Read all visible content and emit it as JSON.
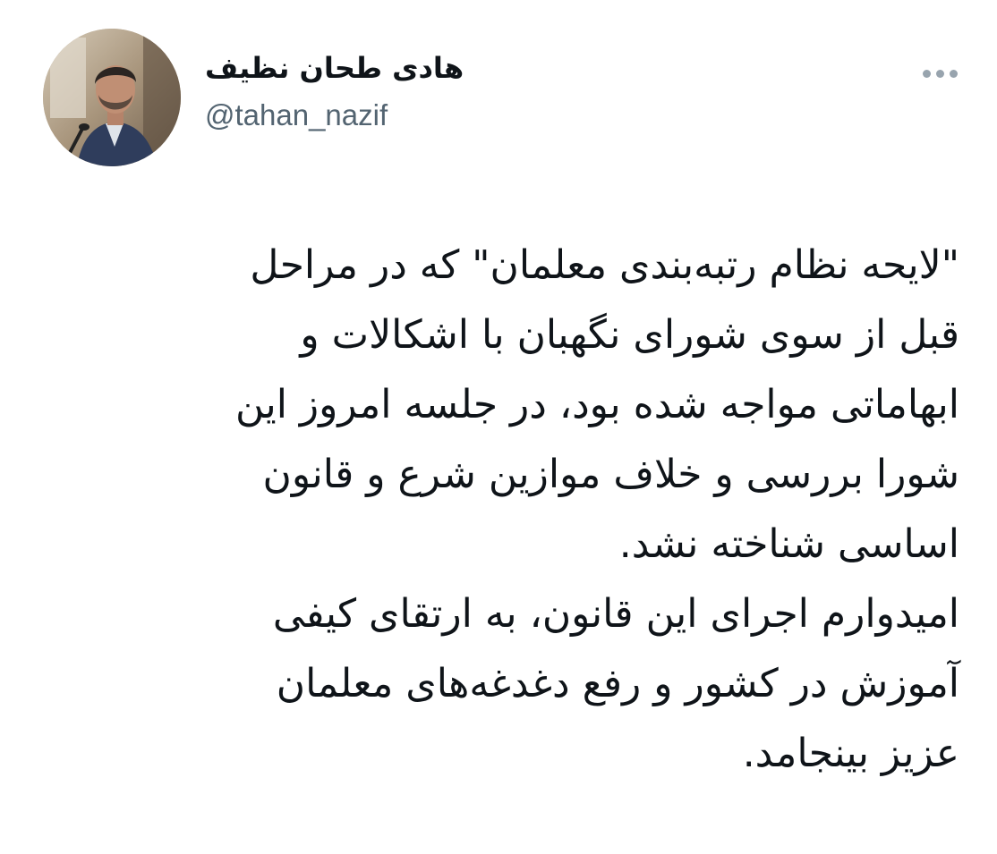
{
  "tweet": {
    "author": {
      "display_name": "هادی طحان نظیف",
      "handle": "@tahan_nazif",
      "avatar_icon": "profile-photo"
    },
    "more_icon": "more-options-icon",
    "text": "\"لایحه نظام رتبه‌بندی معلمان\" که در مراحل\nقبل از سوی شورای نگهبان با اشکالات و\nابهاماتی مواجه شده بود، در جلسه امروز این\nشورا بررسی و خلاف موازین شرع و قانون\nاساسی شناخته نشد.\nامیدوارم اجرای این قانون، به ارتقای کیفی\nآموزش در کشور و رفع دغدغه‌های معلمان\nعزیز بینجامد."
  },
  "colors": {
    "text": "#0f1419",
    "secondary": "#536471",
    "dots": "#98a4ae",
    "background": "#ffffff"
  }
}
